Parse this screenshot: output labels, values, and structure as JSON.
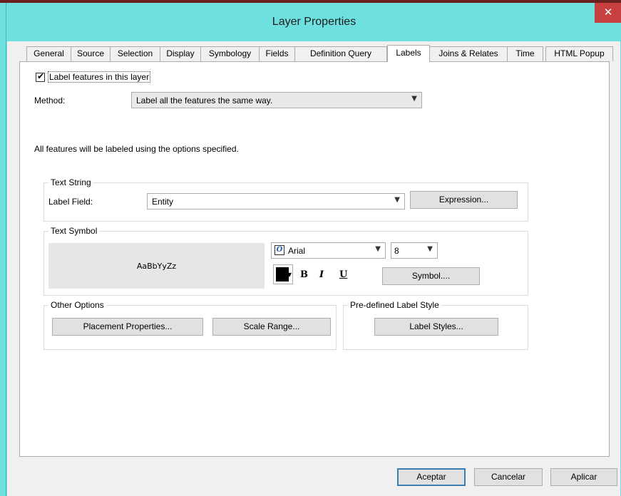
{
  "window": {
    "title": "Layer Properties"
  },
  "tabs": [
    {
      "label": "General"
    },
    {
      "label": "Source"
    },
    {
      "label": "Selection"
    },
    {
      "label": "Display"
    },
    {
      "label": "Symbology"
    },
    {
      "label": "Fields"
    },
    {
      "label": "Definition Query"
    },
    {
      "label": "Labels",
      "active": true
    },
    {
      "label": "Joins & Relates"
    },
    {
      "label": "Time"
    },
    {
      "label": "HTML Popup"
    }
  ],
  "labels_tab": {
    "label_features_checkbox": {
      "label": "Label features in this layer",
      "checked": true
    },
    "method": {
      "label": "Method:",
      "value": "Label all the features the same way."
    },
    "description": "All features will be labeled using the options specified.",
    "text_string": {
      "legend": "Text String",
      "label_field_label": "Label Field:",
      "label_field_value": "Entity",
      "expression_button": "Expression..."
    },
    "text_symbol": {
      "legend": "Text Symbol",
      "preview_text": "AaBbYyZz",
      "font_icon": "O",
      "font_value": "Arial",
      "size_value": "8",
      "color": "#000000",
      "bold": "B",
      "italic": "I",
      "underline": "U",
      "symbol_button": "Symbol...."
    },
    "other_options": {
      "legend": "Other Options",
      "placement_button": "Placement Properties...",
      "scale_range_button": "Scale Range..."
    },
    "predefined_style": {
      "legend": "Pre-defined Label Style",
      "label_styles_button": "Label Styles..."
    }
  },
  "footer": {
    "accept": "Aceptar",
    "cancel": "Cancelar",
    "apply": "Aplicar"
  }
}
